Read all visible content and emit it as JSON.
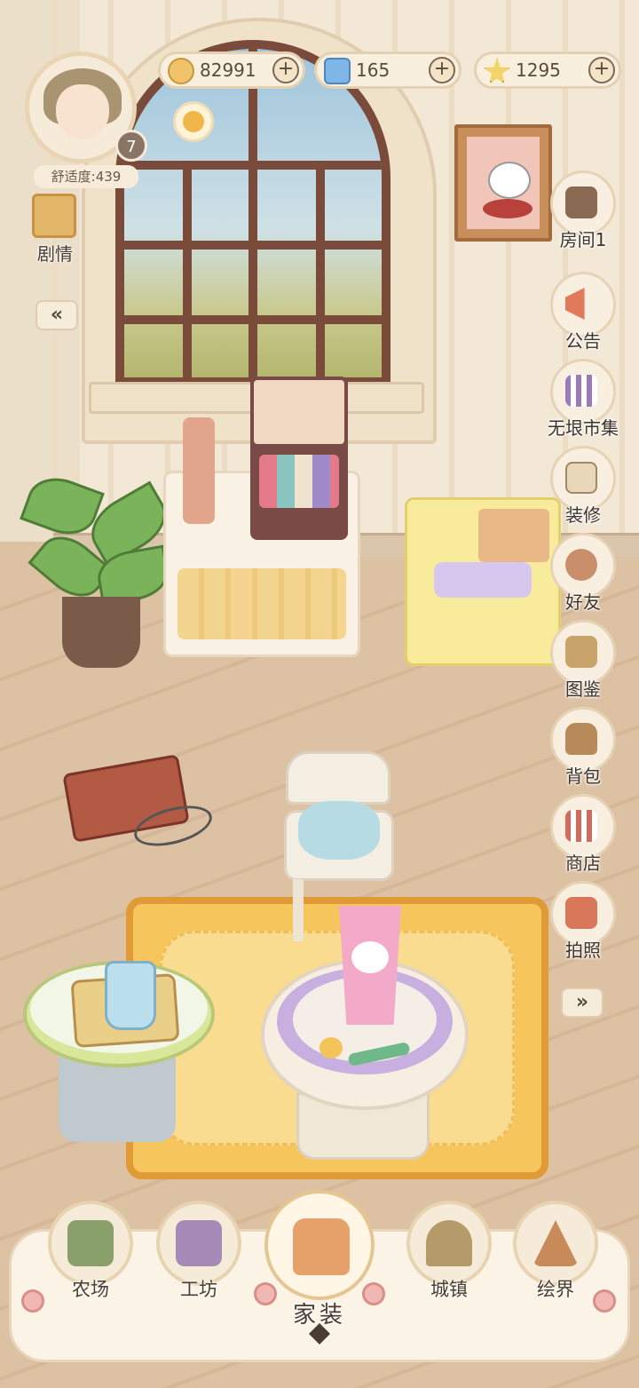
{
  "hud": {
    "currencies": [
      {
        "name": "coin",
        "value": "82991",
        "color": "#f0c36a"
      },
      {
        "name": "crystal",
        "value": "165",
        "color": "#7fb6e8"
      },
      {
        "name": "star",
        "value": "1295",
        "color": "#f3d46a"
      }
    ],
    "plus_symbol": "+",
    "level": "7",
    "comfort": "舒适度:439"
  },
  "left_panel": {
    "story_label": "剧情",
    "collapse_symbol": "«"
  },
  "right_menu": [
    {
      "id": "room",
      "label": "房间1",
      "icon": "room-icon",
      "color": "#8a6a52"
    },
    {
      "id": "notice",
      "label": "公告",
      "icon": "megaphone-icon",
      "color": "#e07a5a"
    },
    {
      "id": "market",
      "label": "无垠市集",
      "icon": "market-stall-icon",
      "color": "#9a7ab8"
    },
    {
      "id": "decorate",
      "label": "装修",
      "icon": "paint-roller-icon",
      "color": "#e8d7b8"
    },
    {
      "id": "friends",
      "label": "好友",
      "icon": "friends-icon",
      "color": "#c98f6a"
    },
    {
      "id": "handbook",
      "label": "图鉴",
      "icon": "open-book-icon",
      "color": "#c9a46a"
    },
    {
      "id": "bag",
      "label": "背包",
      "icon": "backpack-icon",
      "color": "#b88a5a"
    },
    {
      "id": "shop",
      "label": "商店",
      "icon": "shop-icon",
      "color": "#d46a5a"
    },
    {
      "id": "photo",
      "label": "拍照",
      "icon": "camera-icon",
      "color": "#d9775a"
    }
  ],
  "expand_symbol": "»",
  "bottom_nav": [
    {
      "id": "farm",
      "label": "农场",
      "icon": "farm-icon",
      "color": "#8aa06a"
    },
    {
      "id": "workshop",
      "label": "工坊",
      "icon": "workshop-icon",
      "color": "#a88ab8"
    },
    {
      "id": "home",
      "label": "家装",
      "icon": "armchair-icon",
      "color": "#e6a06a"
    },
    {
      "id": "town",
      "label": "城镇",
      "icon": "town-gate-icon",
      "color": "#b59a6a"
    },
    {
      "id": "art",
      "label": "绘界",
      "icon": "easel-icon",
      "color": "#c98a5a"
    }
  ],
  "colors": {
    "wall": "#f3e8d6",
    "floor": "#ddc1a3",
    "window_frame": "#7a4a3a",
    "rug": "#f6c55b",
    "ui_panel": "#fbf4e6"
  }
}
